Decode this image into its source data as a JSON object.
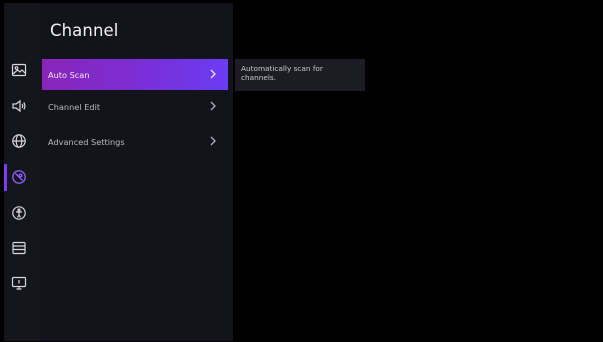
{
  "panel": {
    "title": "Channel"
  },
  "menu": {
    "items": [
      {
        "label": "Auto Scan",
        "active": true
      },
      {
        "label": "Channel Edit",
        "active": false
      },
      {
        "label": "Advanced Settings",
        "active": false
      }
    ]
  },
  "tooltip": {
    "text": "Automatically scan for channels."
  },
  "rail": {
    "icons": [
      "picture-icon",
      "sound-icon",
      "network-icon",
      "channel-icon",
      "accessibility-icon",
      "system-icon",
      "support-icon"
    ],
    "active_icon": "channel-icon"
  },
  "colors": {
    "accent": "#7b3ff0",
    "active_gradient_start": "#8a24b8",
    "active_gradient_end": "#6a3cf3",
    "panel_bg": "#13131b",
    "tooltip_bg": "#1c1c24"
  }
}
